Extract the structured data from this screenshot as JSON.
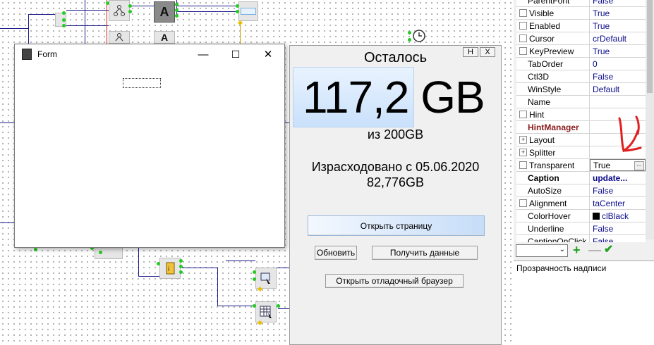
{
  "form_window": {
    "title": "Form",
    "minimize_glyph": "—",
    "maximize_glyph": "☐",
    "close_glyph": "✕"
  },
  "panel": {
    "header_buttons": [
      "H",
      "X"
    ],
    "remaining_label": "Осталось",
    "big_value": "117,2 GB",
    "of_total": "из 200GB",
    "spent_line1": "Израсходовано с 05.06.2020",
    "spent_line2": "82,776GB",
    "open_page_button": "Открыть страницу",
    "refresh_button": "Обновить",
    "get_data_button": "Получить данные",
    "debug_browser_button": "Открыть отладочный браузер"
  },
  "inspector": {
    "properties": [
      {
        "name": "ParentFont",
        "value": "False",
        "marker": "indent"
      },
      {
        "name": "Visible",
        "value": "True",
        "marker": "check"
      },
      {
        "name": "Enabled",
        "value": "True",
        "marker": "check"
      },
      {
        "name": "Cursor",
        "value": "crDefault",
        "marker": "check"
      },
      {
        "name": "KeyPreview",
        "value": "True",
        "marker": "check"
      },
      {
        "name": "TabOrder",
        "value": "0",
        "marker": "indent"
      },
      {
        "name": "Ctl3D",
        "value": "False",
        "marker": "indent"
      },
      {
        "name": "WinStyle",
        "value": "Default",
        "marker": "indent"
      },
      {
        "name": "Name",
        "value": "",
        "marker": "indent"
      },
      {
        "name": "Hint",
        "value": "",
        "marker": "check"
      },
      {
        "name": "HintManager",
        "value": "",
        "marker": "indent",
        "style": "bold-red"
      },
      {
        "name": "Layout",
        "value": "",
        "marker": "expand"
      },
      {
        "name": "Splitter",
        "value": "",
        "marker": "expand"
      },
      {
        "name": "Transparent",
        "value": "True",
        "marker": "check",
        "selected": true
      },
      {
        "name": "Caption",
        "value": "update...",
        "marker": "indent",
        "style": "bold"
      },
      {
        "name": "AutoSize",
        "value": "False",
        "marker": "indent"
      },
      {
        "name": "Alignment",
        "value": "taCenter",
        "marker": "check"
      },
      {
        "name": "ColorHover",
        "value": "clBlack",
        "marker": "indent",
        "swatch": "#000000"
      },
      {
        "name": "Underline",
        "value": "False",
        "marker": "indent"
      },
      {
        "name": "CaptionOnClick",
        "value": "False",
        "marker": "indent"
      }
    ],
    "ellipsis_glyph": "…",
    "combo_arrow_glyph": "⌄",
    "add_glyph": "+",
    "remove_glyph": "—",
    "apply_glyph": "✔",
    "description": "Прозрачность надписи"
  },
  "colors": {
    "wire": "#1b1b8a",
    "annotation": "#e02020",
    "pin": "#22cc22",
    "highlight": "#c9e0fb"
  },
  "icons": [
    "form-icon",
    "clock-icon",
    "info-component-icon",
    "label-component-icon",
    "share-component-icon",
    "edit-component-icon",
    "grid-component-icon"
  ]
}
